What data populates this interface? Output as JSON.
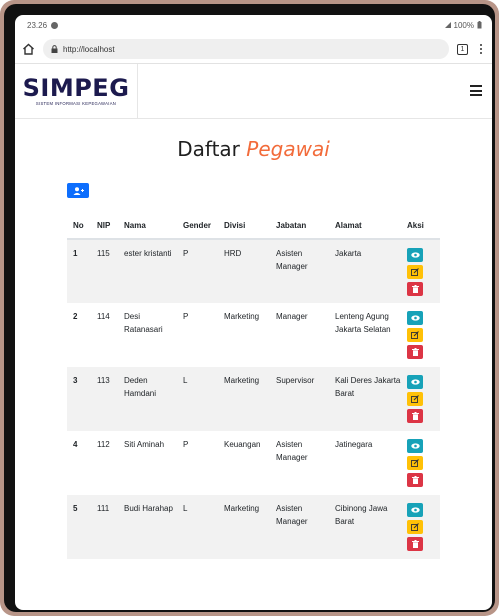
{
  "status": {
    "time": "23.26",
    "battery": "100%"
  },
  "browser": {
    "url": "http://localhost",
    "tab_count": "1"
  },
  "brand": {
    "title": "SIMPEG",
    "subtitle": "SISTEM INFORMASI KEPEGAWAIAN"
  },
  "page": {
    "title_main": "Daftar",
    "title_accent": "Pegawai"
  },
  "colors": {
    "primary": "#0d6efd",
    "accent": "#f26b3a",
    "info": "#17a2b8",
    "warning": "#ffc107",
    "danger": "#dc3545",
    "brand": "#1c1a4e"
  },
  "table": {
    "headers": [
      "No",
      "NIP",
      "Nama",
      "Gender",
      "Divisi",
      "Jabatan",
      "Alamat",
      "Aksi"
    ],
    "rows": [
      {
        "no": "1",
        "nip": "115",
        "nama": "ester kristanti",
        "gender": "P",
        "divisi": "HRD",
        "jabatan": "Asisten Manager",
        "alamat": "Jakarta"
      },
      {
        "no": "2",
        "nip": "114",
        "nama": "Desi Ratanasari",
        "gender": "P",
        "divisi": "Marketing",
        "jabatan": "Manager",
        "alamat": "Lenteng Agung Jakarta Selatan"
      },
      {
        "no": "3",
        "nip": "113",
        "nama": "Deden Hamdani",
        "gender": "L",
        "divisi": "Marketing",
        "jabatan": "Supervisor",
        "alamat": "Kali Deres Jakarta Barat"
      },
      {
        "no": "4",
        "nip": "112",
        "nama": "Siti Aminah",
        "gender": "P",
        "divisi": "Keuangan",
        "jabatan": "Asisten Manager",
        "alamat": "Jatinegara"
      },
      {
        "no": "5",
        "nip": "111",
        "nama": "Budi Harahap",
        "gender": "L",
        "divisi": "Marketing",
        "jabatan": "Asisten Manager",
        "alamat": "Cibinong Jawa Barat"
      }
    ],
    "actions": [
      "view-icon",
      "edit-icon",
      "trash-icon"
    ]
  }
}
